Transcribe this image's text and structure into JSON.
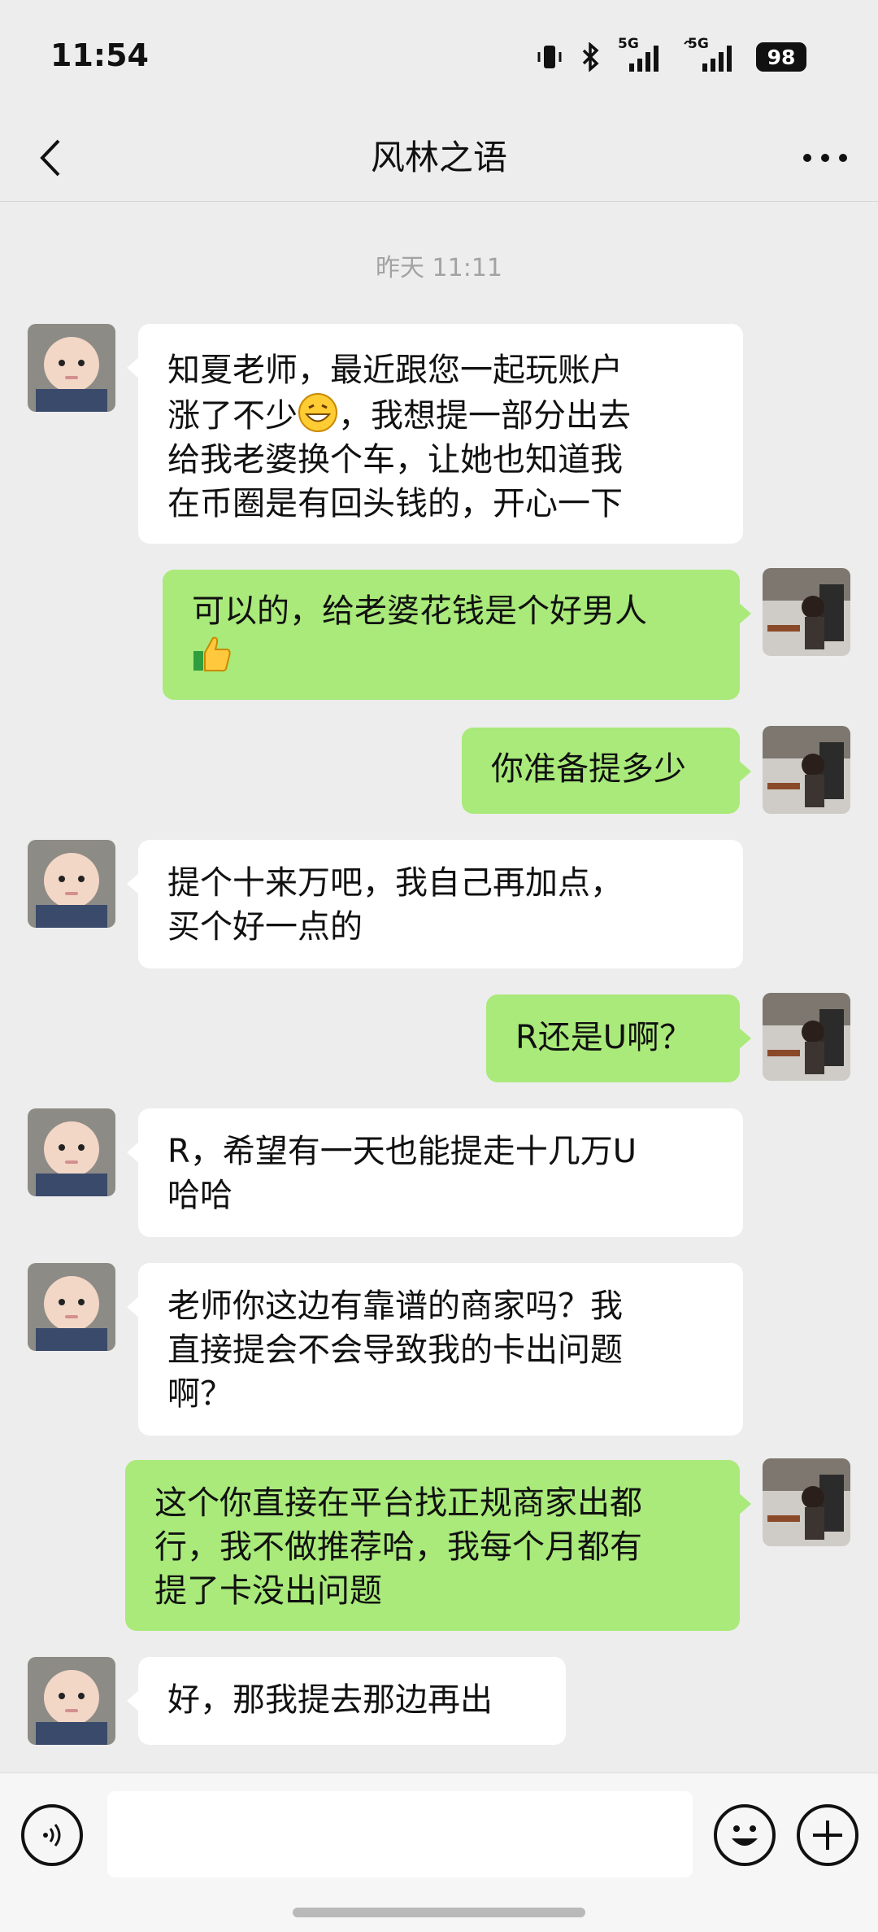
{
  "status_bar": {
    "time": "11:54",
    "network_1": "5G",
    "network_2": "5G",
    "battery": "98"
  },
  "header": {
    "title": "风林之语",
    "back_icon": "chevron-left-icon",
    "more_icon": "more-dots-icon"
  },
  "timestamp": "昨天 11:11",
  "messages": [
    {
      "side": "in",
      "lines": [
        "知夏老师，最近跟您一起玩账户",
        "涨了不少",
        "，我想提一部分出去",
        "给我老婆换个车，让她也知道我",
        "在币圈是有回头钱的，开心一下"
      ],
      "emoji": "grin-emoji"
    },
    {
      "side": "out",
      "text": "可以的，给老婆花钱是个好男人",
      "emoji": "thumbs-up-emoji"
    },
    {
      "side": "out",
      "text": "你准备提多少"
    },
    {
      "side": "in",
      "lines": [
        "提个十来万吧，我自己再加点，",
        "买个好一点的"
      ]
    },
    {
      "side": "out",
      "text": "R还是U啊？"
    },
    {
      "side": "in",
      "lines": [
        "R，希望有一天也能提走十几万U",
        "哈哈"
      ]
    },
    {
      "side": "in",
      "lines": [
        "老师你这边有靠谱的商家吗？我",
        "直接提会不会导致我的卡出问题",
        "啊？"
      ]
    },
    {
      "side": "out",
      "lines": [
        "这个你直接在平台找正规商家出都",
        "行，我不做推荐哈，我每个月都有",
        "提了卡没出问题"
      ]
    },
    {
      "side": "in",
      "text": "好，那我提去那边再出"
    }
  ],
  "input_bar": {
    "voice_icon": "voice-icon",
    "input_value": "",
    "emoji_icon": "emoji-icon",
    "plus_icon": "plus-icon"
  }
}
